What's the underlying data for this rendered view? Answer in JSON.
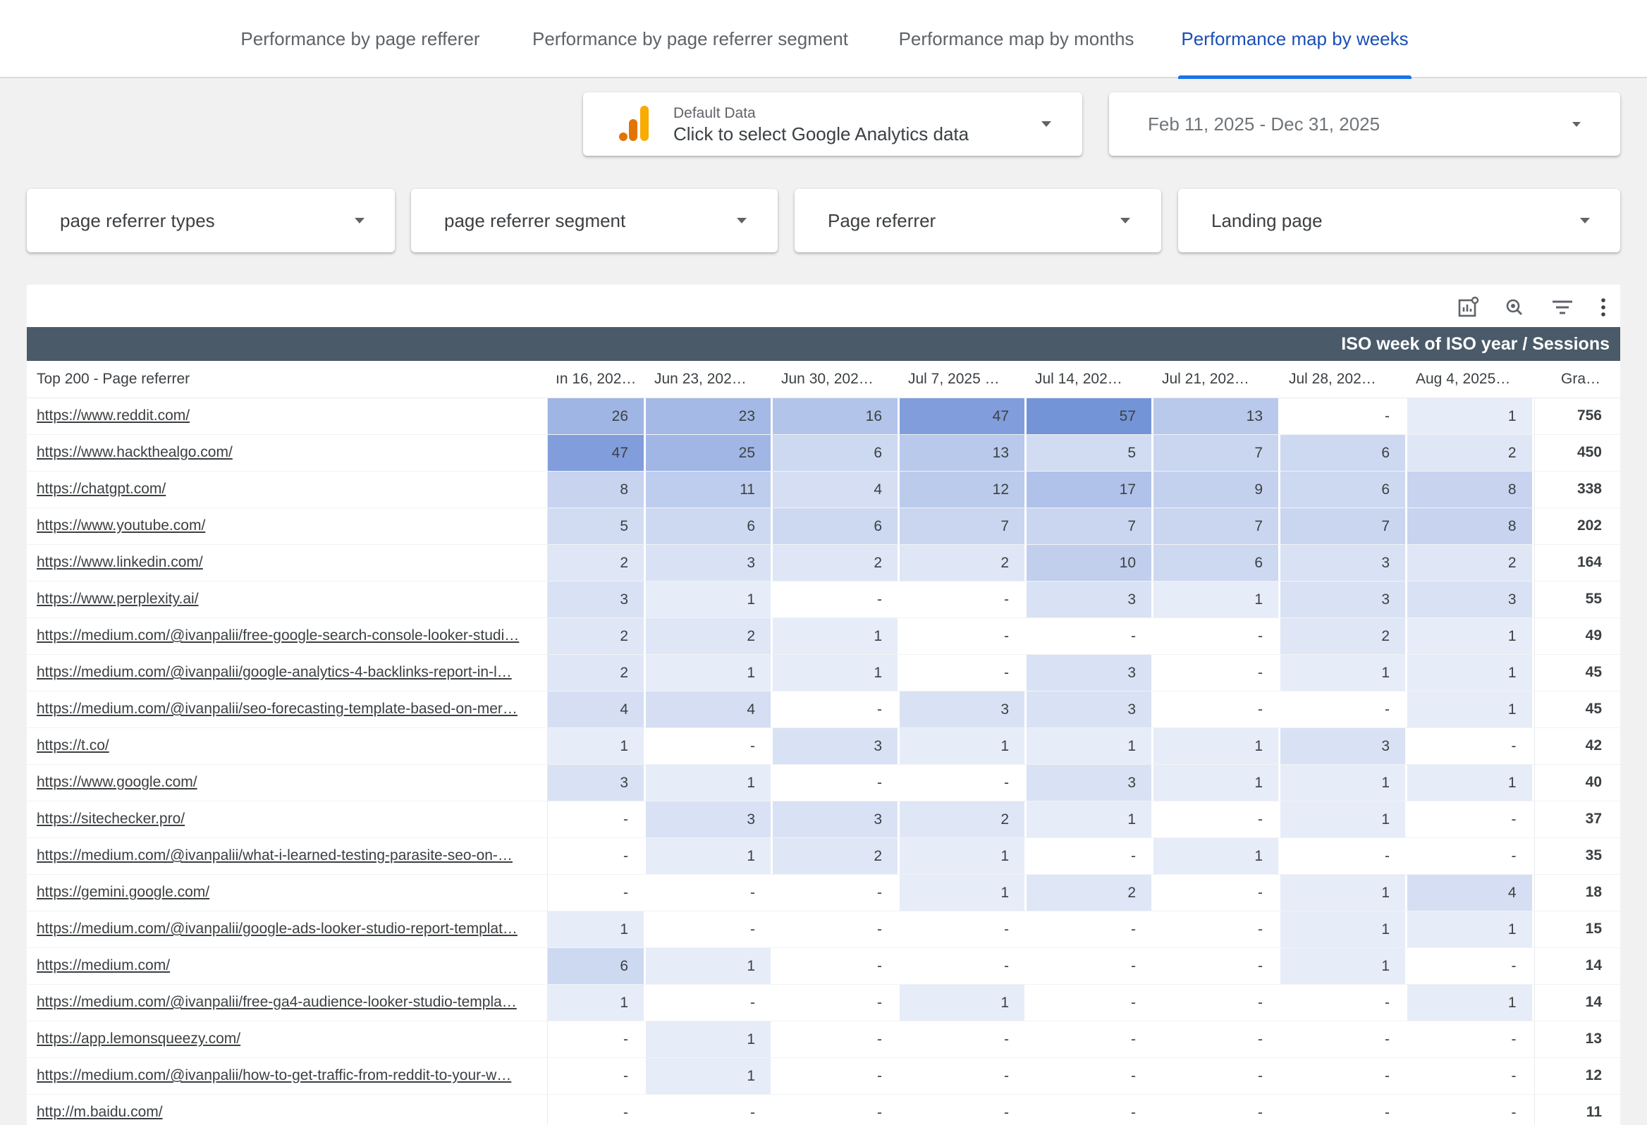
{
  "tabs": [
    {
      "label": "Performance by page refferer",
      "active": false
    },
    {
      "label": "Performance by page referrer segment",
      "active": false
    },
    {
      "label": "Performance map by months",
      "active": false
    },
    {
      "label": "Performance map by weeks",
      "active": true
    }
  ],
  "data_source": {
    "small_label": "Default Data",
    "main_label": "Click to select Google Analytics data"
  },
  "date_range": {
    "label": "Feb 11, 2025 - Dec 31, 2025"
  },
  "filters": {
    "referrer_types": "page referrer types",
    "referrer_segment": "page referrer segment",
    "page_referrer": "Page referrer",
    "landing_page": "Landing page"
  },
  "table": {
    "header_band": "ISO week of ISO year / Sessions",
    "first_column": "Top 200 - Page referrer",
    "week_columns": [
      "ın 16, 202…",
      "Jun 23, 202…",
      "Jun 30, 202…",
      "Jul 7, 2025 …",
      "Jul 14, 202…",
      "Jul 21, 202…",
      "Jul 28, 202…",
      "Aug 4, 2025…"
    ],
    "total_column": "Gra…",
    "heat_color": "#3f6bc9",
    "heat_max": 57,
    "rows": [
      {
        "ref": "https://www.reddit.com/",
        "vals": [
          "26",
          "23",
          "16",
          "47",
          "57",
          "13",
          "-",
          "1"
        ],
        "total": "756"
      },
      {
        "ref": "https://www.hackthealgo.com/",
        "vals": [
          "47",
          "25",
          "6",
          "13",
          "5",
          "7",
          "6",
          "2"
        ],
        "total": "450"
      },
      {
        "ref": "https://chatgpt.com/",
        "vals": [
          "8",
          "11",
          "4",
          "12",
          "17",
          "9",
          "6",
          "8"
        ],
        "total": "338"
      },
      {
        "ref": "https://www.youtube.com/",
        "vals": [
          "5",
          "6",
          "6",
          "7",
          "7",
          "7",
          "7",
          "8"
        ],
        "total": "202"
      },
      {
        "ref": "https://www.linkedin.com/",
        "vals": [
          "2",
          "3",
          "2",
          "2",
          "10",
          "6",
          "3",
          "2"
        ],
        "total": "164"
      },
      {
        "ref": "https://www.perplexity.ai/",
        "vals": [
          "3",
          "1",
          "-",
          "-",
          "3",
          "1",
          "3",
          "3"
        ],
        "total": "55"
      },
      {
        "ref": "https://medium.com/@ivanpalii/free-google-search-console-looker-studi…",
        "vals": [
          "2",
          "2",
          "1",
          "-",
          "-",
          "-",
          "2",
          "1"
        ],
        "total": "49"
      },
      {
        "ref": "https://medium.com/@ivanpalii/google-analytics-4-backlinks-report-in-l…",
        "vals": [
          "2",
          "1",
          "1",
          "-",
          "3",
          "-",
          "1",
          "1"
        ],
        "total": "45"
      },
      {
        "ref": "https://medium.com/@ivanpalii/seo-forecasting-template-based-on-mer…",
        "vals": [
          "4",
          "4",
          "-",
          "3",
          "3",
          "-",
          "-",
          "1"
        ],
        "total": "45"
      },
      {
        "ref": "https://t.co/",
        "vals": [
          "1",
          "-",
          "3",
          "1",
          "1",
          "1",
          "3",
          "-"
        ],
        "total": "42"
      },
      {
        "ref": "https://www.google.com/",
        "vals": [
          "3",
          "1",
          "-",
          "-",
          "3",
          "1",
          "1",
          "1"
        ],
        "total": "40"
      },
      {
        "ref": "https://sitechecker.pro/",
        "vals": [
          "-",
          "3",
          "3",
          "2",
          "1",
          "-",
          "1",
          "-"
        ],
        "total": "37"
      },
      {
        "ref": "https://medium.com/@ivanpalii/what-i-learned-testing-parasite-seo-on-…",
        "vals": [
          "-",
          "1",
          "2",
          "1",
          "-",
          "1",
          "-",
          "-"
        ],
        "total": "35"
      },
      {
        "ref": "https://gemini.google.com/",
        "vals": [
          "-",
          "-",
          "-",
          "1",
          "2",
          "-",
          "1",
          "4"
        ],
        "total": "18"
      },
      {
        "ref": "https://medium.com/@ivanpalii/google-ads-looker-studio-report-templat…",
        "vals": [
          "1",
          "-",
          "-",
          "-",
          "-",
          "-",
          "1",
          "1"
        ],
        "total": "15"
      },
      {
        "ref": "https://medium.com/",
        "vals": [
          "6",
          "1",
          "-",
          "-",
          "-",
          "-",
          "1",
          "-"
        ],
        "total": "14"
      },
      {
        "ref": "https://medium.com/@ivanpalii/free-ga4-audience-looker-studio-templa…",
        "vals": [
          "1",
          "-",
          "-",
          "1",
          "-",
          "-",
          "-",
          "1"
        ],
        "total": "14"
      },
      {
        "ref": "https://app.lemonsqueezy.com/",
        "vals": [
          "-",
          "1",
          "-",
          "-",
          "-",
          "-",
          "-",
          "-"
        ],
        "total": "13"
      },
      {
        "ref": "https://medium.com/@ivanpalii/how-to-get-traffic-from-reddit-to-your-w…",
        "vals": [
          "-",
          "1",
          "-",
          "-",
          "-",
          "-",
          "-",
          "-"
        ],
        "total": "12"
      },
      {
        "ref": "http://m.baidu.com/",
        "vals": [
          "-",
          "-",
          "-",
          "-",
          "-",
          "-",
          "-",
          "-"
        ],
        "total": "11"
      }
    ]
  }
}
